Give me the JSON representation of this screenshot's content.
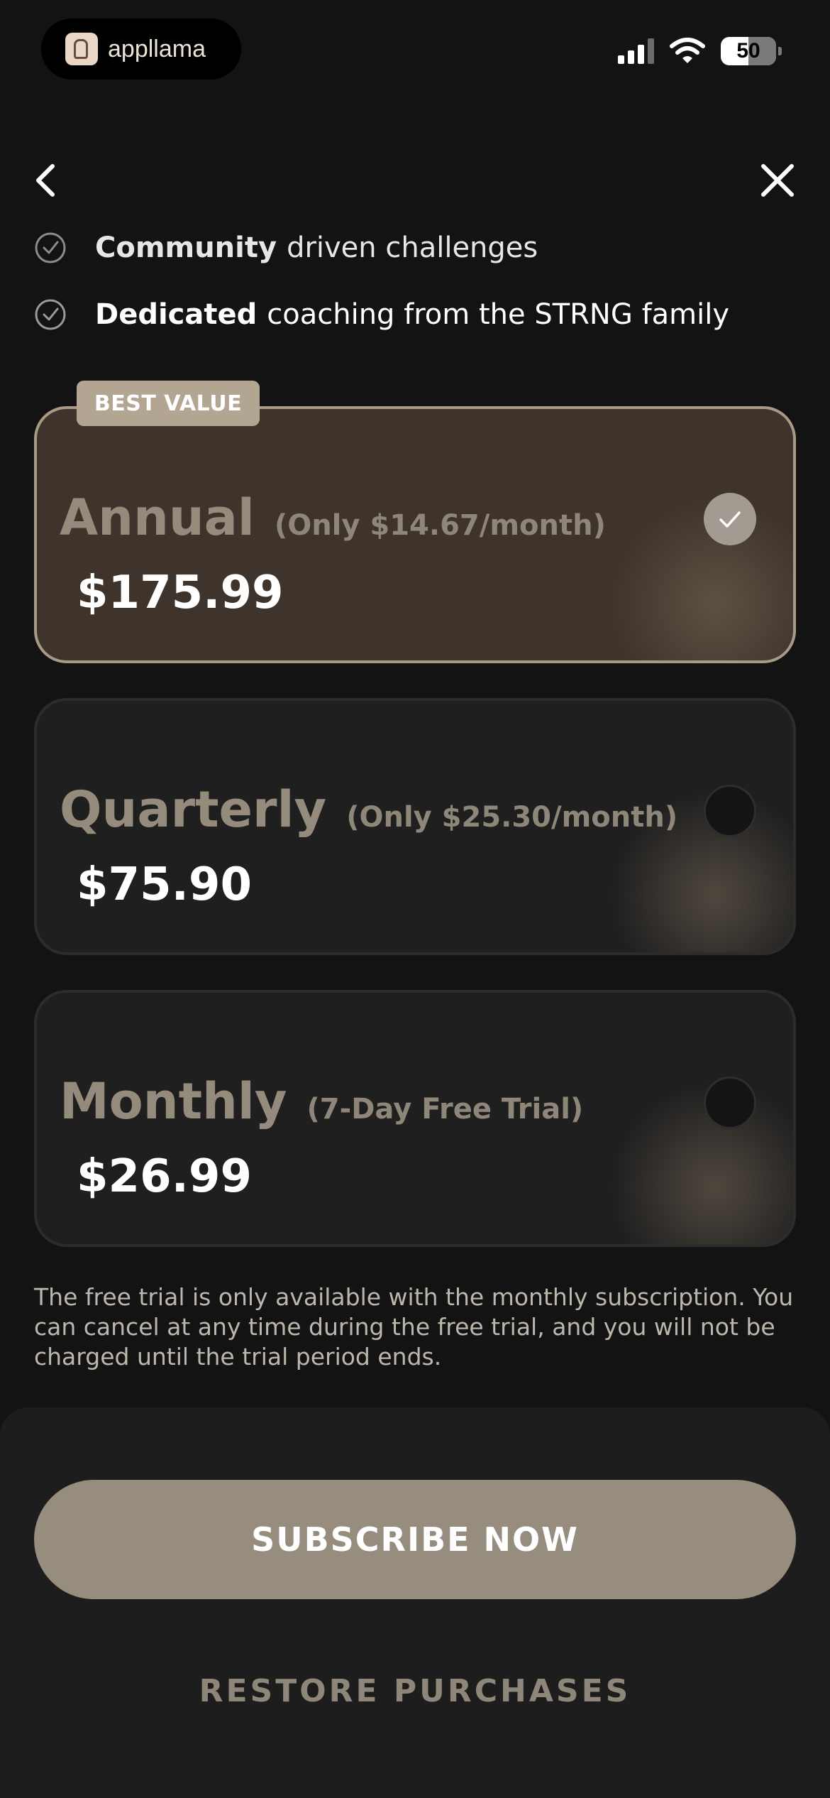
{
  "status_bar": {
    "app_brand": "appllama",
    "battery": "50"
  },
  "features": [
    {
      "bold": "Community",
      "rest": "driven challenges"
    },
    {
      "bold": "Dedicated",
      "rest": "coaching from the STRNG family"
    }
  ],
  "badge": "BEST VALUE",
  "plans": [
    {
      "name": "Annual",
      "note": "(Only $14.67/month)",
      "price": "$175.99",
      "selected": true
    },
    {
      "name": "Quarterly",
      "note": "(Only $25.30/month)",
      "price": "$75.90",
      "selected": false
    },
    {
      "name": "Monthly",
      "note": "(7-Day Free Trial)",
      "price": "$26.99",
      "selected": false
    }
  ],
  "disclaimer": "The free trial is only available with the monthly subscription. You can cancel at any time during the free trial, and you will not be charged until the trial period ends.",
  "buttons": {
    "subscribe": "SUBSCRIBE NOW",
    "restore": "RESTORE PURCHASES"
  },
  "colors": {
    "accent": "#978d7f",
    "selected_card": "#3e342b",
    "background": "#131313"
  }
}
